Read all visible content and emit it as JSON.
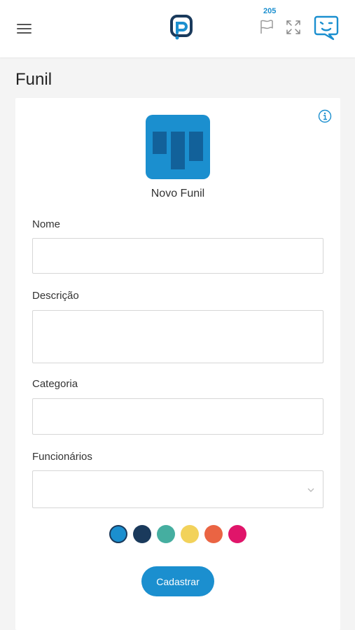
{
  "header": {
    "menu_icon": "hamburger-icon",
    "logo_icon": "app-logo-icon",
    "flag_count": "205",
    "flag_icon": "flag-icon",
    "expand_icon": "fullscreen-icon",
    "chat_icon": "chat-face-icon",
    "accent_color": "#1b8fcf"
  },
  "page": {
    "title": "Funil"
  },
  "form": {
    "info_icon": "info-icon",
    "funnel_icon": "kanban-board-icon",
    "funnel_name": "Novo Funil",
    "fields": {
      "name": {
        "label": "Nome",
        "value": "",
        "placeholder": ""
      },
      "description": {
        "label": "Descrição",
        "value": "",
        "placeholder": ""
      },
      "category": {
        "label": "Categoria",
        "value": "",
        "placeholder": ""
      },
      "employees": {
        "label": "Funcionários",
        "value": ""
      }
    },
    "colors": [
      {
        "name": "blue",
        "hex": "#1b8fcf",
        "selected": true
      },
      {
        "name": "navy",
        "hex": "#1a3a5c",
        "selected": false
      },
      {
        "name": "teal",
        "hex": "#45aea0",
        "selected": false
      },
      {
        "name": "yellow",
        "hex": "#f2d25b",
        "selected": false
      },
      {
        "name": "orange",
        "hex": "#ea6443",
        "selected": false
      },
      {
        "name": "pink",
        "hex": "#e0156a",
        "selected": false
      }
    ],
    "submit_label": "Cadastrar"
  }
}
